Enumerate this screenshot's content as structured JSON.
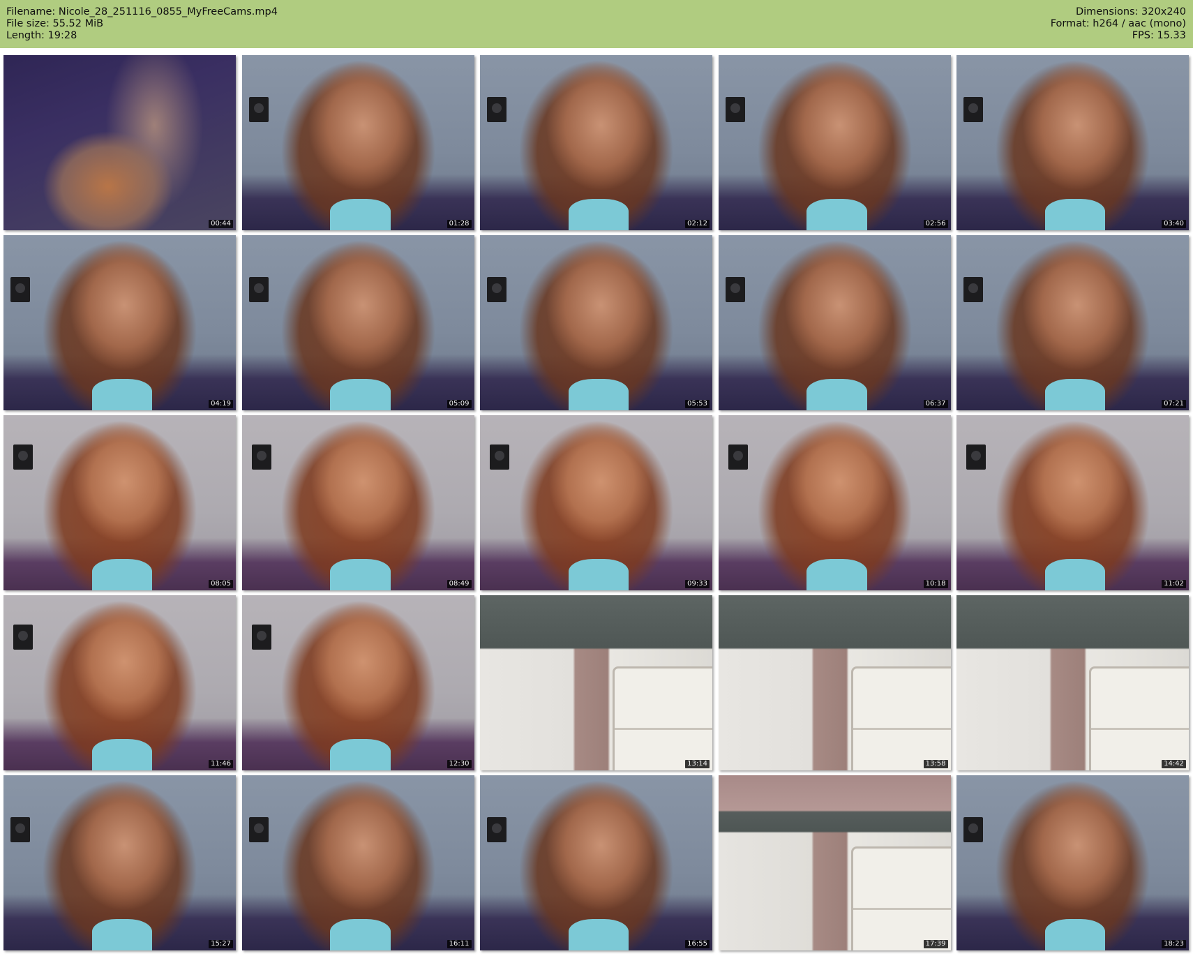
{
  "header": {
    "filename_line": "Filename: Nicole_28_251116_0855_MyFreeCams.mp4",
    "filesize_line": "File size: 55.52 MiB",
    "length_line": "Length: 19:28",
    "dimensions_line": "Dimensions: 320x240",
    "format_line": "Format: h264 / aac (mono)",
    "fps_line": "FPS: 15.33",
    "background_color": "#b0cc80"
  },
  "thumbnails": [
    {
      "time": "00:44",
      "scene": "blanket"
    },
    {
      "time": "01:28",
      "scene": "room"
    },
    {
      "time": "02:12",
      "scene": "room"
    },
    {
      "time": "02:56",
      "scene": "room"
    },
    {
      "time": "03:40",
      "scene": "room"
    },
    {
      "time": "04:19",
      "scene": "room"
    },
    {
      "time": "05:09",
      "scene": "room"
    },
    {
      "time": "05:53",
      "scene": "room"
    },
    {
      "time": "06:37",
      "scene": "room"
    },
    {
      "time": "07:21",
      "scene": "room"
    },
    {
      "time": "08:05",
      "scene": "room-light"
    },
    {
      "time": "08:49",
      "scene": "room-light"
    },
    {
      "time": "09:33",
      "scene": "room-light"
    },
    {
      "time": "10:18",
      "scene": "room-light"
    },
    {
      "time": "11:02",
      "scene": "room-light"
    },
    {
      "time": "11:46",
      "scene": "room-light"
    },
    {
      "time": "12:30",
      "scene": "room-light"
    },
    {
      "time": "13:14",
      "scene": "cabinet"
    },
    {
      "time": "13:58",
      "scene": "cabinet"
    },
    {
      "time": "14:42",
      "scene": "cabinet"
    },
    {
      "time": "15:27",
      "scene": "room"
    },
    {
      "time": "16:11",
      "scene": "room"
    },
    {
      "time": "16:55",
      "scene": "room"
    },
    {
      "time": "17:39",
      "scene": "mixed"
    },
    {
      "time": "18:23",
      "scene": "room"
    }
  ]
}
